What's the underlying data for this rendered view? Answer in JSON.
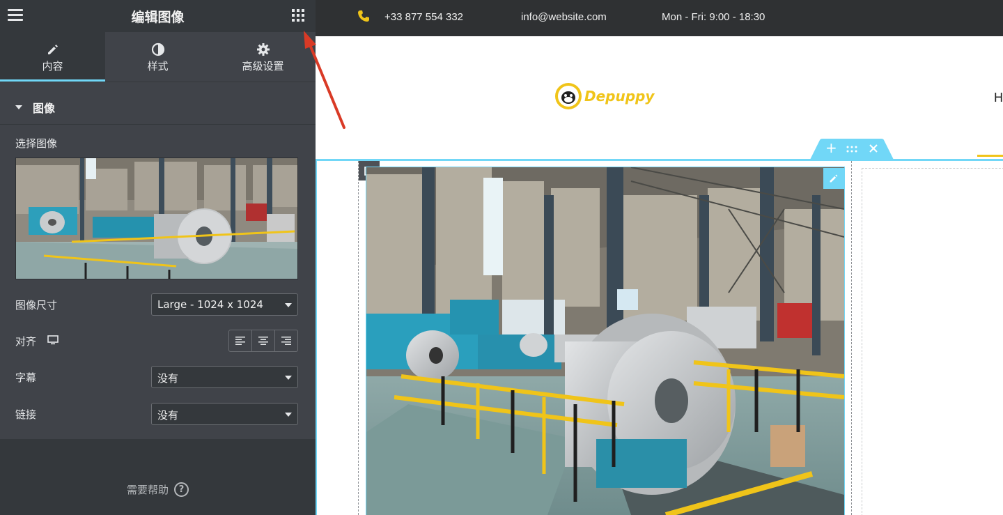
{
  "panel": {
    "title": "编辑图像",
    "tabs": [
      {
        "label": "内容",
        "icon": "pencil-icon",
        "active": true
      },
      {
        "label": "样式",
        "icon": "half-circle-icon",
        "active": false
      },
      {
        "label": "高级设置",
        "icon": "gear-icon",
        "active": false
      }
    ],
    "section": {
      "title": "图像"
    },
    "choose_image_label": "选择图像",
    "image_size": {
      "label": "图像尺寸",
      "value": "Large - 1024 x 1024"
    },
    "alignment": {
      "label": "对齐",
      "options": [
        "left",
        "center",
        "right"
      ]
    },
    "caption": {
      "label": "字幕",
      "value": "没有"
    },
    "link": {
      "label": "链接",
      "value": "没有"
    },
    "help_label": "需要帮助",
    "help_icon": "?"
  },
  "topbar": {
    "phone": "+33 877 554 332",
    "email": "info@website.com",
    "hours": "Mon - Fri: 9:00 - 18:30"
  },
  "site": {
    "logo_text": "Depuppy",
    "nav_first_letter": "H"
  },
  "colors": {
    "accent": "#71d7f7",
    "brand_yellow": "#f0c419",
    "panel_bg": "#404349",
    "annotation_arrow": "#d93a26"
  }
}
